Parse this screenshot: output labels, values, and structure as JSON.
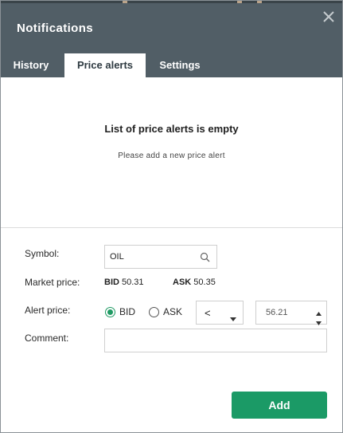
{
  "dialog": {
    "title": "Notifications",
    "close_icon": "close-icon"
  },
  "tabs": [
    {
      "label": "History",
      "active": false
    },
    {
      "label": "Price alerts",
      "active": true
    },
    {
      "label": "Settings",
      "active": false
    }
  ],
  "empty_state": {
    "title": "List of price alerts is empty",
    "subtitle": "Please add a new price alert"
  },
  "form": {
    "symbol_label": "Symbol:",
    "symbol_value": "OIL",
    "search_icon": "search-icon",
    "market_price_label": "Market price:",
    "bid_label": "BID",
    "bid_value": "50.31",
    "ask_label": "ASK",
    "ask_value": "50.35",
    "alert_price_label": "Alert price:",
    "side_options": [
      {
        "label": "BID",
        "selected": true
      },
      {
        "label": "ASK",
        "selected": false
      }
    ],
    "operator_value": "<",
    "alert_price_value": "56.21",
    "comment_label": "Comment:",
    "comment_value": ""
  },
  "actions": {
    "add_label": "Add"
  },
  "colors": {
    "header": "#515e66",
    "accent_green": "#1b9a66"
  }
}
